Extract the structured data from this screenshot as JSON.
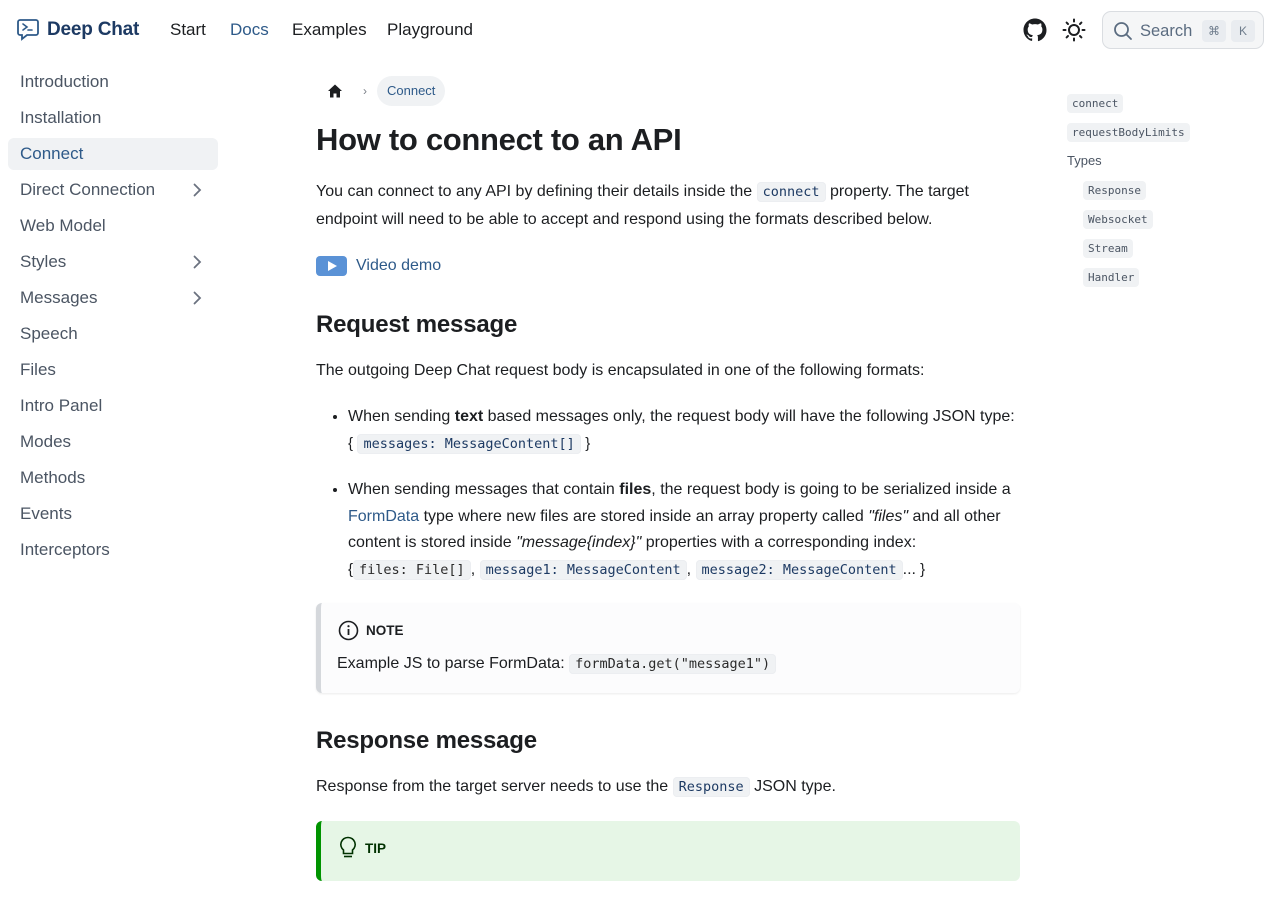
{
  "navbar": {
    "brand": "Deep Chat",
    "links": [
      {
        "label": "Start",
        "active": false
      },
      {
        "label": "Docs",
        "active": true
      },
      {
        "label": "Examples",
        "active": false
      },
      {
        "label": "Playground",
        "active": false
      }
    ],
    "search": {
      "label": "Search",
      "key1": "⌘",
      "key2": "K"
    }
  },
  "sidebar": {
    "items": [
      {
        "label": "Introduction",
        "expandable": false,
        "active": false
      },
      {
        "label": "Installation",
        "expandable": false,
        "active": false
      },
      {
        "label": "Connect",
        "expandable": false,
        "active": true
      },
      {
        "label": "Direct Connection",
        "expandable": true,
        "active": false
      },
      {
        "label": "Web Model",
        "expandable": false,
        "active": false
      },
      {
        "label": "Styles",
        "expandable": true,
        "active": false
      },
      {
        "label": "Messages",
        "expandable": true,
        "active": false
      },
      {
        "label": "Speech",
        "expandable": false,
        "active": false
      },
      {
        "label": "Files",
        "expandable": false,
        "active": false
      },
      {
        "label": "Intro Panel",
        "expandable": false,
        "active": false
      },
      {
        "label": "Modes",
        "expandable": false,
        "active": false
      },
      {
        "label": "Methods",
        "expandable": false,
        "active": false
      },
      {
        "label": "Events",
        "expandable": false,
        "active": false
      },
      {
        "label": "Interceptors",
        "expandable": false,
        "active": false
      }
    ]
  },
  "breadcrumb": {
    "current": "Connect",
    "separator": "›"
  },
  "main": {
    "title": "How to connect to an API",
    "intro_before": "You can connect to any API by defining their details inside the ",
    "intro_code": "connect",
    "intro_after": " property. The target endpoint will need to be able to accept and respond using the formats described below.",
    "video_label": "Video demo",
    "request": {
      "heading": "Request message",
      "lead": "The outgoing Deep Chat request body is encapsulated in one of the following formats:",
      "item1_a": "When sending ",
      "item1_bold": "text",
      "item1_b": " based messages only, the request body will have the following JSON type:",
      "item1_code": "messages: MessageContent[]",
      "item2_a": "When sending messages that contain ",
      "item2_bold": "files",
      "item2_b": ", the request body is going to be serialized inside a ",
      "item2_link": "FormData",
      "item2_c": " type where new files are stored inside an array property called ",
      "item2_files": "\"files\"",
      "item2_d": " and all other content is stored inside ",
      "item2_msg": "\"message{index}\"",
      "item2_e": " properties with a corresponding index:",
      "item2_code1": "files: File[]",
      "item2_code2": "message1: MessageContent",
      "item2_code3": "message2: MessageContent",
      "item2_ellipsis": "..."
    },
    "note": {
      "label": "NOTE",
      "text": "Example JS to parse FormData: ",
      "code": "formData.get(\"message1\")"
    },
    "response": {
      "heading": "Response message",
      "before": "Response from the target server needs to use the ",
      "code": "Response",
      "after": " JSON type."
    },
    "tip": {
      "label": "TIP"
    }
  },
  "toc": {
    "items": [
      {
        "label": "connect",
        "code": true,
        "indent": false
      },
      {
        "label": "requestBodyLimits",
        "code": true,
        "indent": false
      },
      {
        "label": "Types",
        "code": false,
        "indent": false
      },
      {
        "label": "Response",
        "code": true,
        "indent": true
      },
      {
        "label": "Websocket",
        "code": true,
        "indent": true
      },
      {
        "label": "Stream",
        "code": true,
        "indent": true
      },
      {
        "label": "Handler",
        "code": true,
        "indent": true
      }
    ]
  }
}
